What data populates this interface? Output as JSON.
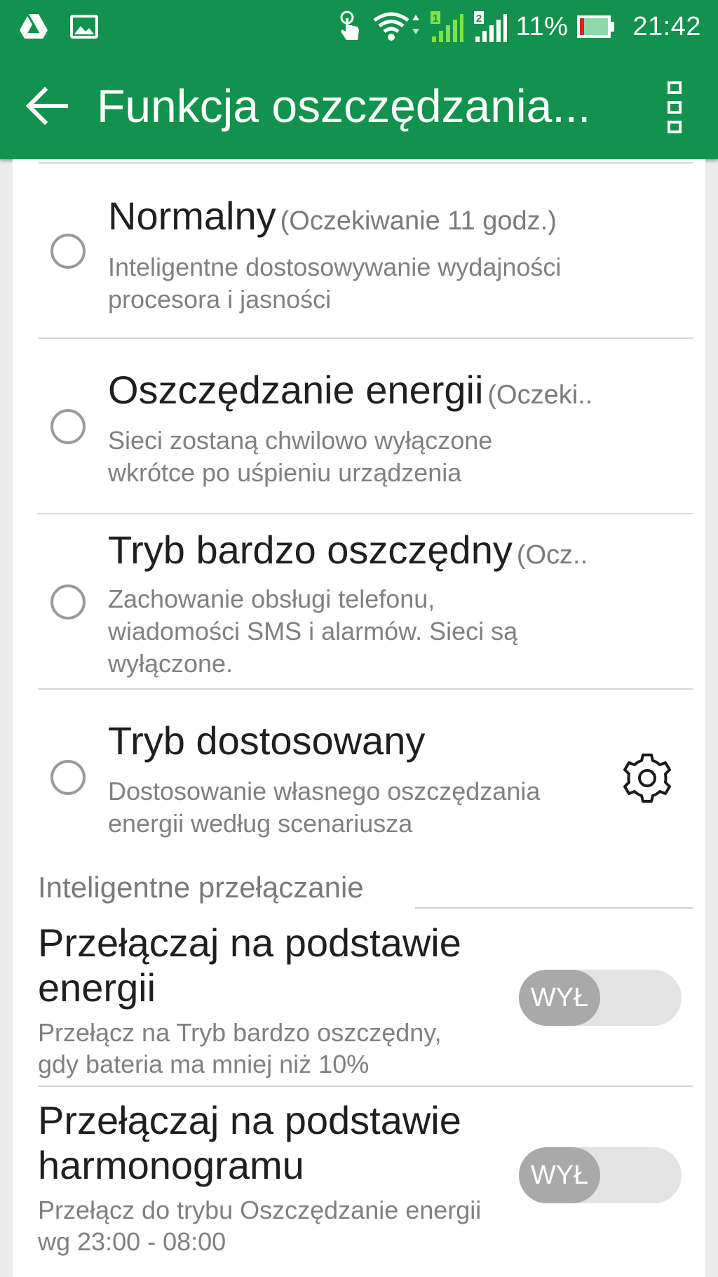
{
  "status_bar": {
    "left_icons": [
      "drive-icon",
      "image-icon"
    ],
    "right_icons": [
      "touch-icon",
      "wifi-icon",
      "signal-sim1-icon",
      "signal-sim2-icon",
      "battery-icon"
    ],
    "battery_percent": "11%",
    "time": "21:42"
  },
  "app_bar": {
    "title": "Funkcja oszczędzania...",
    "back_icon": "arrow-left-icon",
    "menu_icon": "overflow-menu-icon"
  },
  "modes": [
    {
      "title": "Normalny",
      "note": "(Oczekiwanie 11 godz.)",
      "description": "Inteligentne dostosowywanie wydajności procesora i jasności",
      "selected": false
    },
    {
      "title": "Oszczędzanie energii",
      "note": "(Oczeki..",
      "description": "Sieci zostaną chwilowo wyłączone wkrótce po uśpieniu urządzenia",
      "selected": false
    },
    {
      "title": "Tryb bardzo oszczędny",
      "note": "(Ocz..",
      "description": "Zachowanie obsługi telefonu, wiadomości SMS i alarmów. Sieci są wyłączone.",
      "selected": false
    },
    {
      "title": "Tryb dostosowany",
      "description": "Dostosowanie własnego oszczędzania energii według scenariusza",
      "selected": false,
      "action_icon": "gear-icon"
    }
  ],
  "smart_switch": {
    "header": "Inteligentne przełączanie",
    "items": [
      {
        "title": "Przełączaj na podstawie energii",
        "description": "Przełącz na Tryb bardzo oszczędny, gdy bateria ma mniej niż 10%",
        "toggle_label": "WYŁ",
        "enabled": false
      },
      {
        "title": "Przełączaj na podstawie harmonogramu",
        "description": "Przełącz do trybu Oszczędzanie energii wg 23:00 - 08:00",
        "toggle_label": "WYŁ",
        "enabled": false
      }
    ]
  },
  "colors": {
    "app_bar": "#12924d",
    "background": "#ececec",
    "card": "#ffffff",
    "primary_text": "#1f1f1f",
    "secondary_text": "#808080",
    "toggle_track": "#e3e3e3",
    "toggle_knob": "#a9a9a9"
  }
}
